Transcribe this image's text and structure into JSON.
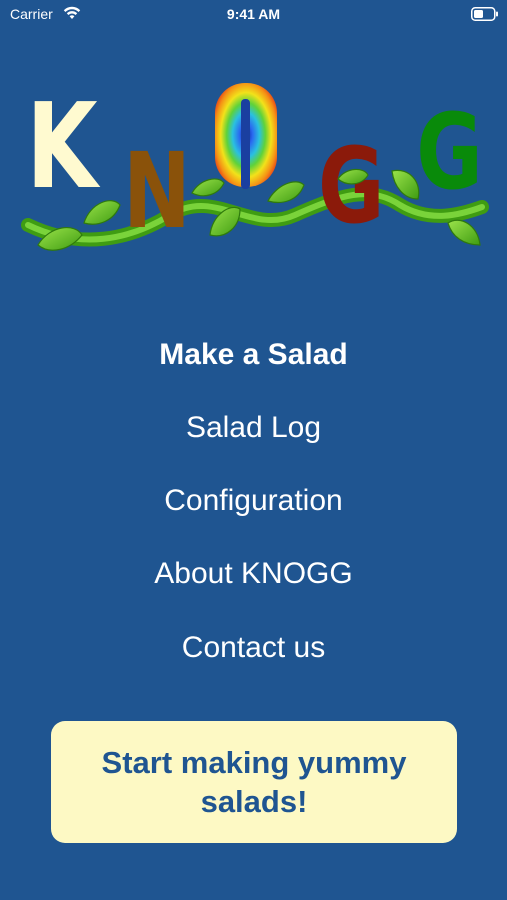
{
  "status_bar": {
    "carrier": "Carrier",
    "time": "9:41 AM",
    "icons": [
      "wifi-icon",
      "battery-icon"
    ]
  },
  "logo": {
    "letters": [
      "K",
      "N",
      "O",
      "G",
      "G"
    ],
    "colors": [
      "#fffad0",
      "#8a520a",
      "rainbow",
      "#8b1a0a",
      "#098a0a"
    ],
    "vine_color": "#5cbf1e"
  },
  "menu": {
    "items": [
      {
        "label": "Make a Salad",
        "active": true
      },
      {
        "label": "Salad Log",
        "active": false
      },
      {
        "label": "Configuration",
        "active": false
      },
      {
        "label": "About KNOGG",
        "active": false
      },
      {
        "label": "Contact us",
        "active": false
      }
    ]
  },
  "cta": {
    "label": "Start making yummy\nsalads!"
  },
  "colors": {
    "background": "#1f5591",
    "cta_background": "#fdf9c4",
    "cta_text": "#1f5591"
  }
}
